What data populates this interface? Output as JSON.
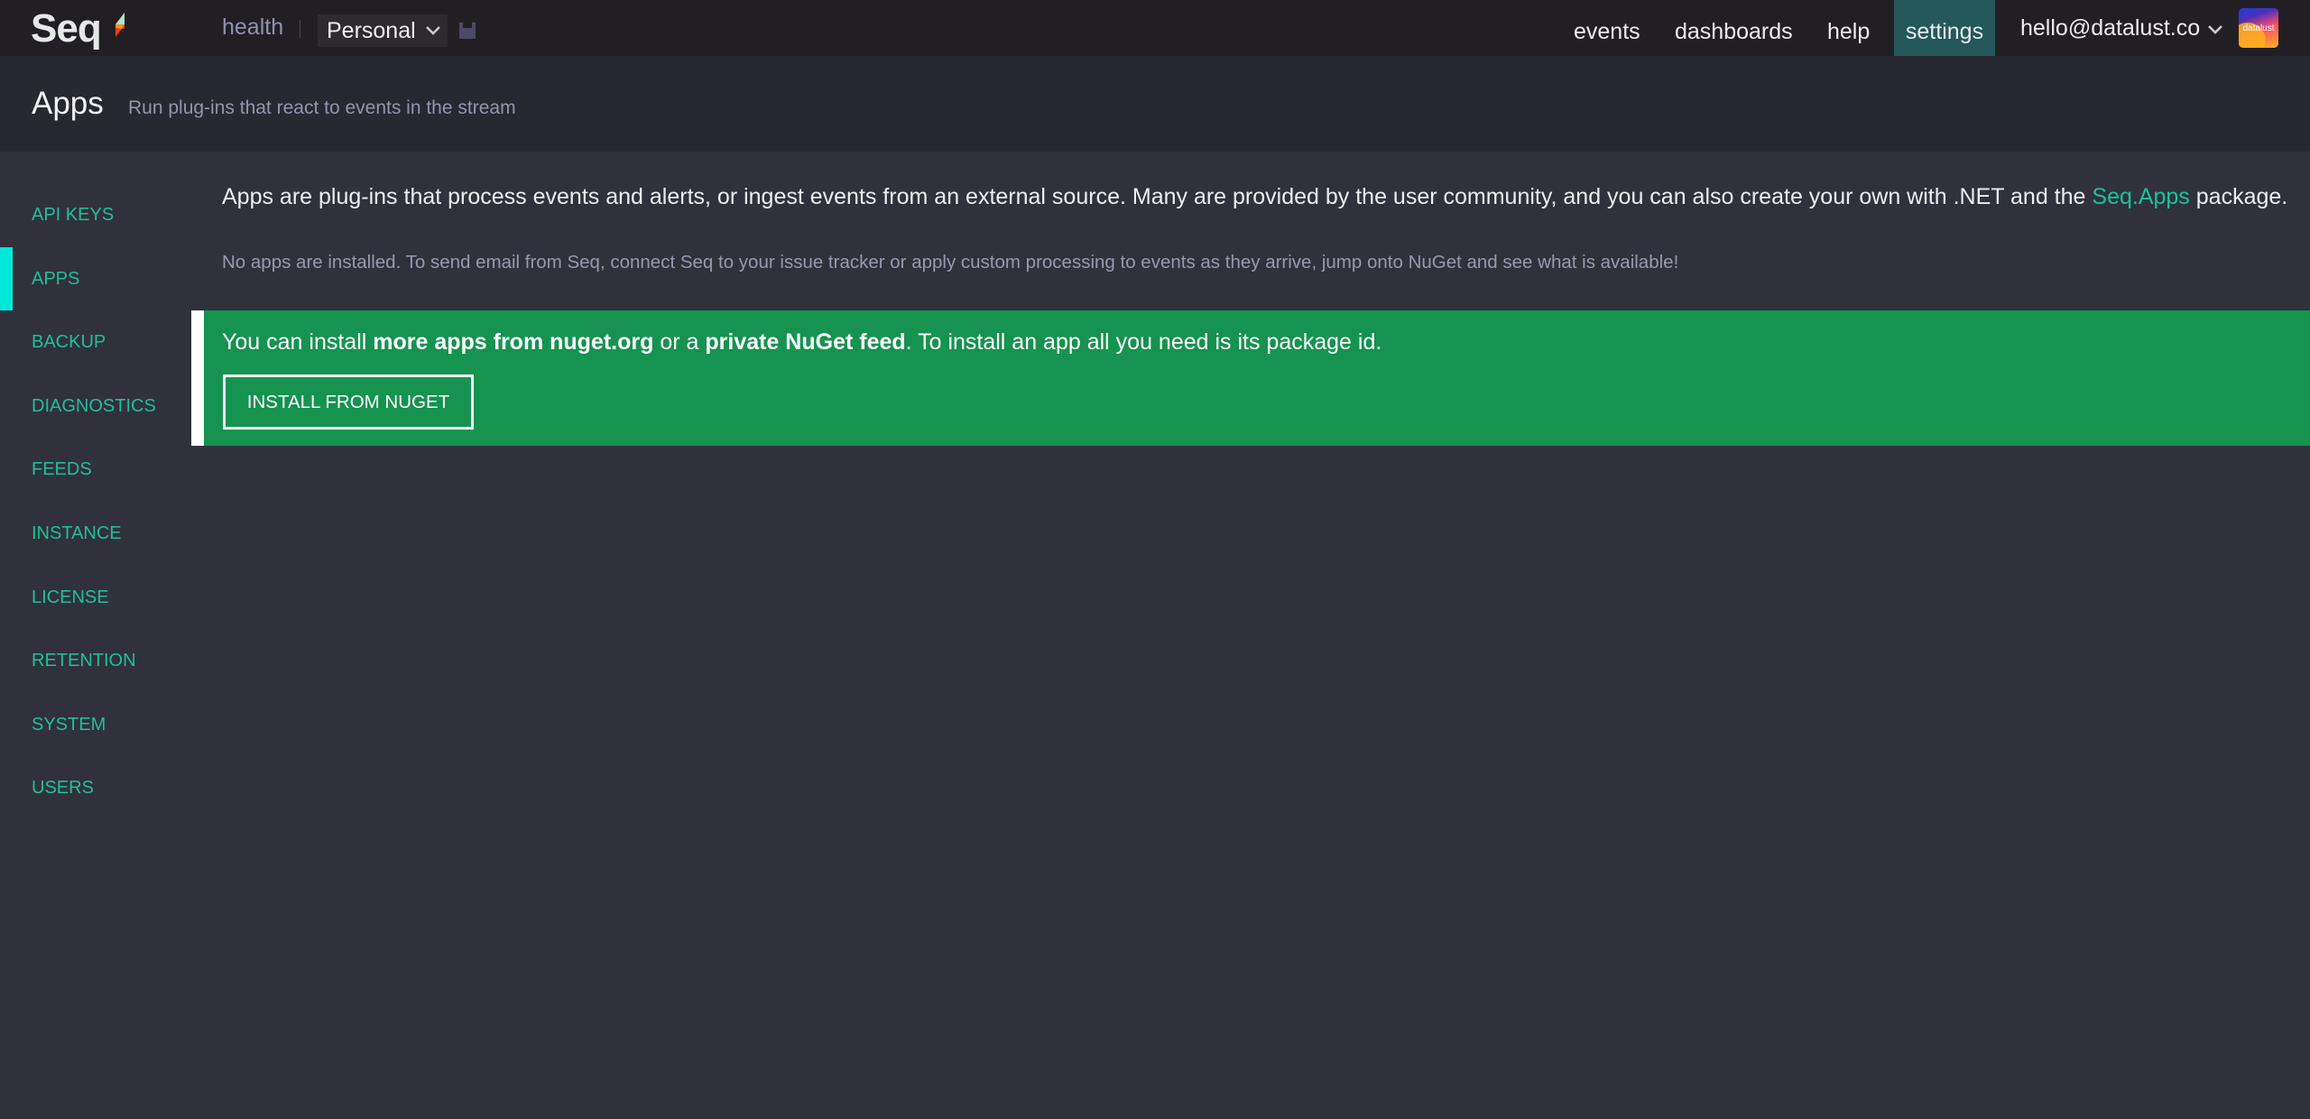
{
  "app": {
    "logo_text": "Seq",
    "brand_colors": {
      "logo_green": "#a8e6cf",
      "logo_orange": "#f7941d",
      "logo_red": "#e8400c"
    }
  },
  "topnav": {
    "health_label": "health",
    "workspace": {
      "selected": "Personal",
      "icon": "chevron-down-icon"
    },
    "save_icon": "save-icon",
    "links": [
      {
        "label": "events",
        "active": false
      },
      {
        "label": "dashboards",
        "active": false
      },
      {
        "label": "help",
        "active": false
      },
      {
        "label": "settings",
        "active": true
      }
    ],
    "user": {
      "email": "hello@datalust.co",
      "icon": "chevron-down-icon",
      "avatar_text": "datalust"
    },
    "active_tab_color": "#24585a"
  },
  "page_header": {
    "title": "Apps",
    "subtitle": "Run plug-ins that react to events in the stream"
  },
  "sidebar": {
    "accent_color": "#00e8d8",
    "link_color": "#1fbf9c",
    "items": [
      {
        "label": "API KEYS",
        "active": false
      },
      {
        "label": "APPS",
        "active": true
      },
      {
        "label": "BACKUP",
        "active": false
      },
      {
        "label": "DIAGNOSTICS",
        "active": false
      },
      {
        "label": "FEEDS",
        "active": false
      },
      {
        "label": "INSTANCE",
        "active": false
      },
      {
        "label": "LICENSE",
        "active": false
      },
      {
        "label": "RETENTION",
        "active": false
      },
      {
        "label": "SYSTEM",
        "active": false
      },
      {
        "label": "USERS",
        "active": false
      }
    ]
  },
  "main": {
    "intro": {
      "before_link": "Apps are plug-ins that process events and alerts, or ingest events from an external source. Many are provided by the user community, and you can also create your own with .NET and the ",
      "link_text": "Seq.Apps",
      "after_link": " package."
    },
    "no_apps_message": "No apps are installed. To send email from Seq, connect Seq to your issue tracker or apply custom processing to events as they arrive, jump onto NuGet and see what is available!",
    "banner": {
      "color": "#15934f",
      "text_1": "You can install ",
      "bold_1": "more apps from nuget.org",
      "text_2": " or a ",
      "bold_2": "private NuGet feed",
      "text_3": ". To install an app all you need is its package id.",
      "button_label": "INSTALL FROM NUGET"
    }
  }
}
